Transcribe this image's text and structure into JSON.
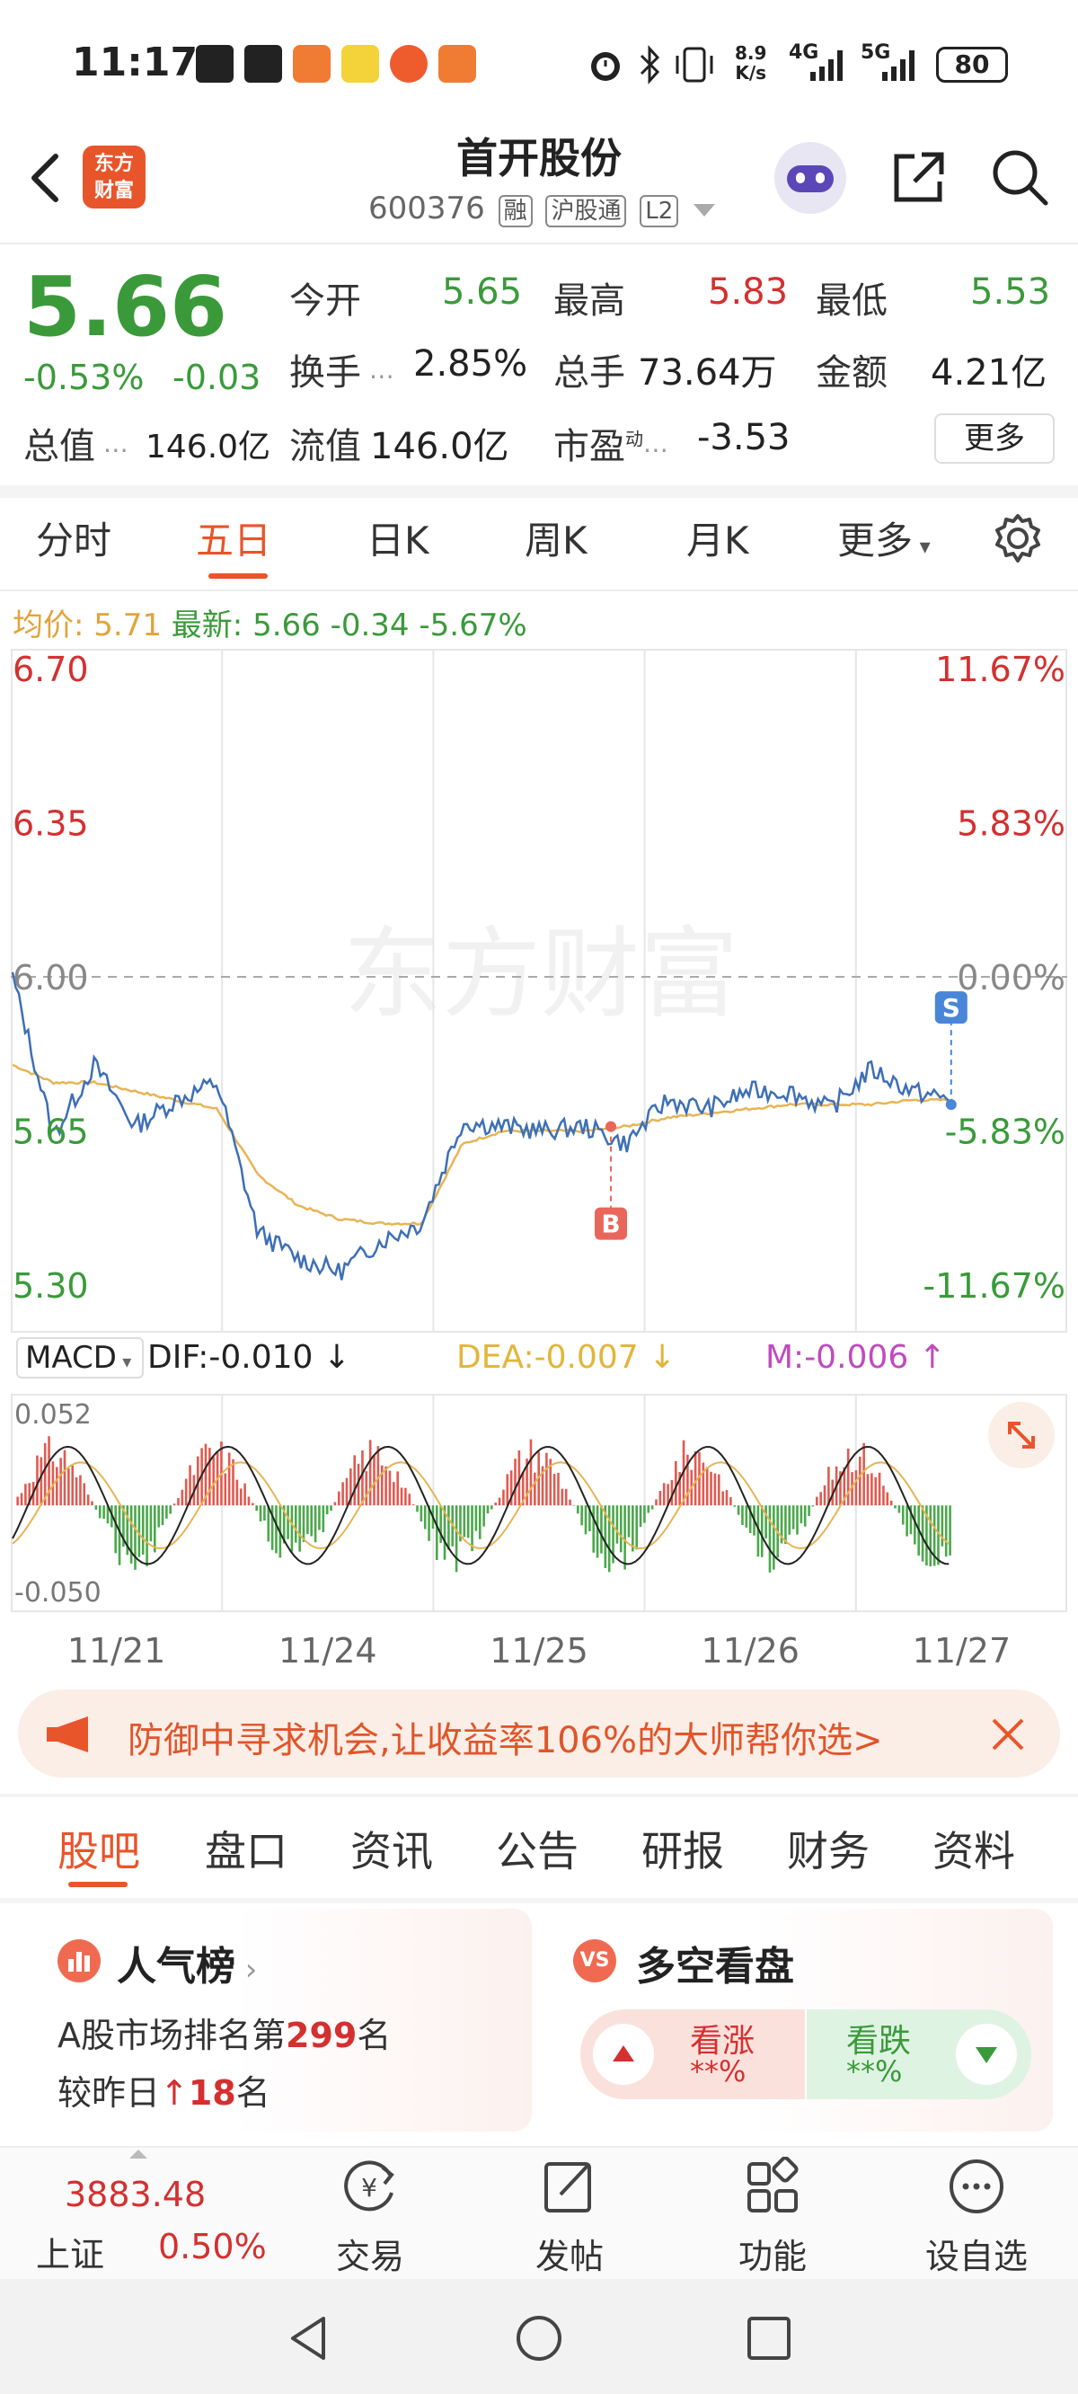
{
  "status_bar": {
    "time": "11:17",
    "net_speed_top": "8.9",
    "net_speed_bottom": "K/s",
    "signal1": "4G",
    "signal2": "5G",
    "battery": "80"
  },
  "header": {
    "logo_line1": "东方",
    "logo_line2": "财富",
    "title": "首开股份",
    "code": "600376",
    "tags": [
      "融",
      "沪股通",
      "L2"
    ]
  },
  "quote": {
    "price": "5.66",
    "change_pct": "-0.53%",
    "change_abs": "-0.03",
    "open_label": "今开",
    "open": "5.65",
    "high_label": "最高",
    "high": "5.83",
    "low_label": "最低",
    "low": "5.53",
    "turnover_label": "换手",
    "turnover": "2.85%",
    "volume_label": "总手",
    "volume": "73.64万",
    "amount_label": "金额",
    "amount": "4.21亿",
    "mktcap_label": "总值",
    "mktcap": "146.0亿",
    "float_label": "流值",
    "float": "146.0亿",
    "pe_label": "市盈",
    "pe_sup": "动",
    "pe": "-3.53",
    "more": "更多"
  },
  "period_tabs": [
    "分时",
    "五日",
    "日K",
    "周K",
    "月K",
    "更多"
  ],
  "active_period": 1,
  "info_line": {
    "avg_label": "均价:",
    "avg": "5.71",
    "latest_label": "最新:",
    "latest": "5.66",
    "chg": "-0.34",
    "pct": "-5.67%"
  },
  "watermark": "东方财富",
  "chart_data": [
    {
      "type": "line",
      "title": "",
      "x": [
        "11/21",
        "11/24",
        "11/25",
        "11/26",
        "11/27"
      ],
      "series": [
        {
          "name": "",
          "values": [
            6.0,
            5.64,
            5.8,
            5.66,
            5.72,
            5.76,
            5.42,
            5.36,
            5.33,
            5.4,
            5.44,
            5.67,
            5.66,
            5.65,
            5.66,
            5.62,
            5.72,
            5.7,
            5.74,
            5.74,
            5.7,
            5.79,
            5.74,
            5.72
          ]
        },
        {
          "name": "",
          "values": [
            5.8,
            5.76,
            5.76,
            5.74,
            5.72,
            5.7,
            5.55,
            5.48,
            5.45,
            5.44,
            5.44,
            5.62,
            5.65,
            5.65,
            5.65,
            5.66,
            5.68,
            5.69,
            5.7,
            5.71,
            5.71,
            5.71,
            5.72,
            5.72
          ]
        }
      ],
      "y_left_ticks": [
        "6.70",
        "6.35",
        "6.00",
        "5.65",
        "5.30"
      ],
      "y_right_ticks": [
        "11.67%",
        "5.83%",
        "0.00%",
        "-5.83%",
        "-11.67%"
      ],
      "ylim": [
        5.3,
        6.7
      ],
      "reference": 6.0,
      "markers": [
        {
          "label": "B",
          "value": 5.66
        },
        {
          "label": "S",
          "value": 5.71
        }
      ]
    },
    {
      "type": "bar",
      "title": "MACD",
      "dif_label": "DIF:-0.010",
      "dea_label": "DEA:-0.007",
      "m_label": "M:-0.006",
      "y_ticks": [
        "0.052",
        "-0.050"
      ],
      "ylim": [
        -0.05,
        0.052
      ]
    }
  ],
  "macd_selector": "MACD",
  "banner": {
    "text": "防御中寻求机会,让收益率106%的大师帮你选>"
  },
  "content_tabs": [
    "股吧",
    "盘口",
    "资讯",
    "公告",
    "研报",
    "财务",
    "资料"
  ],
  "active_content_tab": 0,
  "popularity": {
    "title": "人气榜",
    "rank_prefix": "A股市场排名第",
    "rank": "299",
    "rank_suffix": "名",
    "cmp_prefix": "较昨日",
    "cmp_value": "18",
    "cmp_suffix": "名"
  },
  "sentiment": {
    "title": "多空看盘",
    "bull_label": "看涨",
    "bull_value": "**%",
    "bear_label": "看跌",
    "bear_value": "**%"
  },
  "bottom_nav": {
    "index_value": "3883.48",
    "index_name": "上证",
    "index_pct": "0.50%",
    "items": [
      "交易",
      "发帖",
      "功能",
      "设自选"
    ]
  }
}
